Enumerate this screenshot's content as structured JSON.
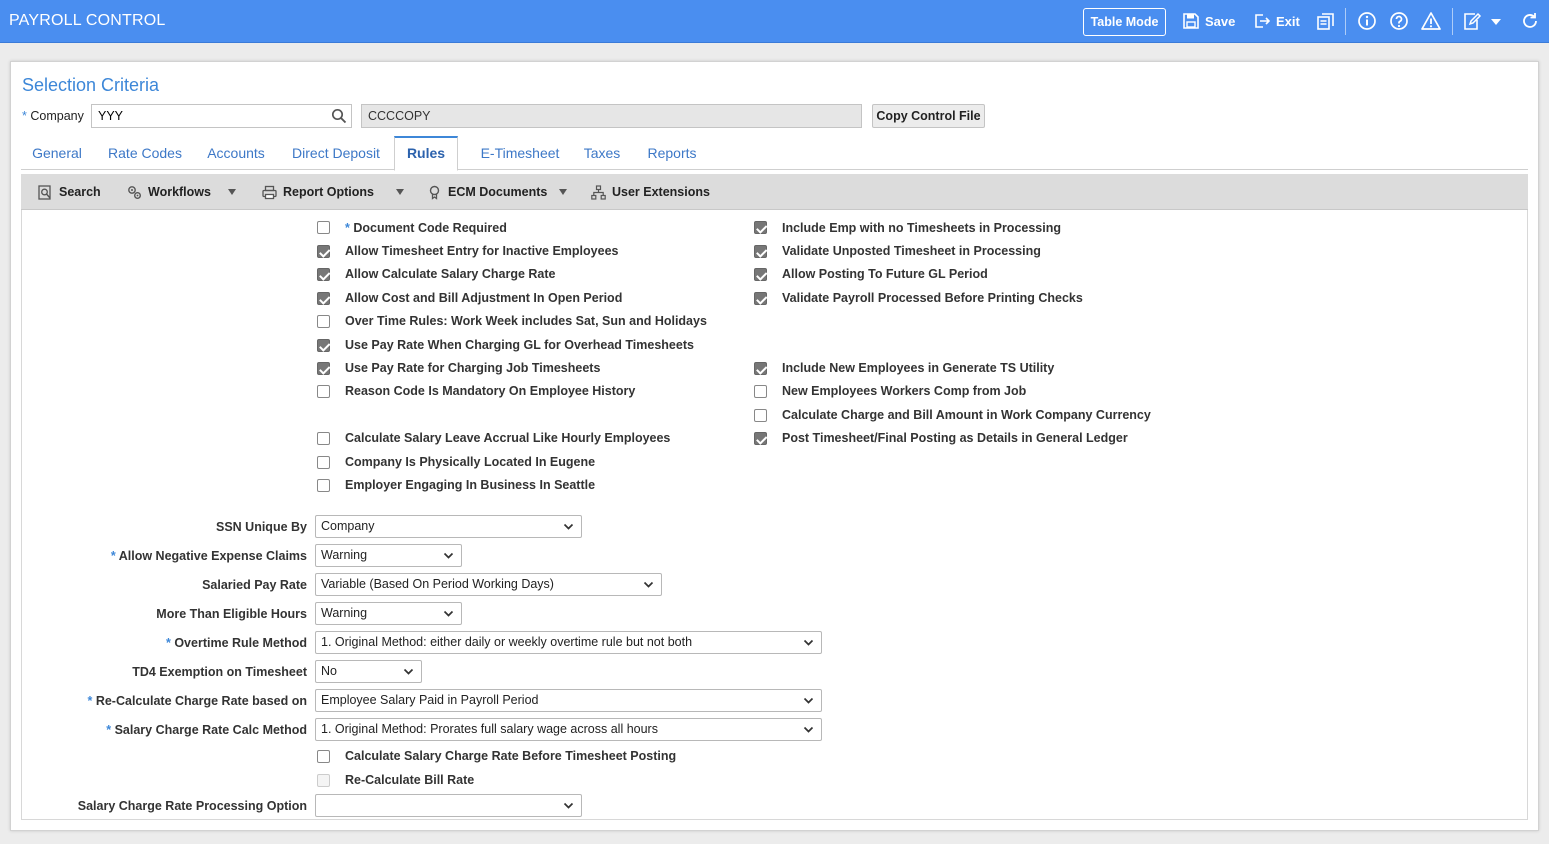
{
  "header": {
    "title": "PAYROLL CONTROL",
    "table_mode": "Table Mode",
    "save": "Save",
    "exit": "Exit"
  },
  "selection": {
    "title": "Selection Criteria",
    "required_mark": "*",
    "company_label": "Company",
    "company_value": "YYY",
    "company_name": "CCCCOPY",
    "copy_button": "Copy Control File"
  },
  "tabs": [
    "General",
    "Rate Codes",
    "Accounts",
    "Direct Deposit",
    "Rules",
    "E-Timesheet",
    "Taxes",
    "Reports"
  ],
  "active_tab": "Rules",
  "toolbar": {
    "search": "Search",
    "workflows": "Workflows",
    "report_options": "Report Options",
    "ecm_documents": "ECM Documents",
    "user_extensions": "User Extensions"
  },
  "rules_left": [
    {
      "label": "Document Code Required",
      "checked": false,
      "required": true
    },
    {
      "label": "Allow Timesheet Entry for Inactive Employees",
      "checked": true
    },
    {
      "label": "Allow Calculate Salary Charge Rate",
      "checked": true
    },
    {
      "label": "Allow Cost and Bill Adjustment In Open Period",
      "checked": true
    },
    {
      "label": "Over Time Rules: Work Week includes Sat, Sun and Holidays",
      "checked": false
    },
    {
      "label": "Use Pay Rate When Charging GL for Overhead Timesheets",
      "checked": true
    },
    {
      "label": "Use Pay Rate for Charging Job Timesheets",
      "checked": true
    },
    {
      "label": "Reason Code Is Mandatory On Employee History",
      "checked": false
    },
    {
      "label": "Calculate Salary Leave Accrual Like Hourly Employees",
      "checked": false
    },
    {
      "label": "Company Is Physically Located In Eugene",
      "checked": false
    },
    {
      "label": "Employer Engaging In Business In Seattle",
      "checked": false
    }
  ],
  "rules_right": [
    {
      "label": "Include Emp with no Timesheets in Processing",
      "checked": true
    },
    {
      "label": "Validate Unposted Timesheet in Processing",
      "checked": true
    },
    {
      "label": "Allow Posting To Future GL Period",
      "checked": true
    },
    {
      "label": "Validate Payroll Processed Before Printing Checks",
      "checked": true
    },
    {
      "label": "Include New Employees in Generate TS Utility",
      "checked": true
    },
    {
      "label": "New Employees Workers Comp from Job",
      "checked": false
    },
    {
      "label": "Calculate Charge and Bill Amount in Work Company Currency",
      "checked": false
    },
    {
      "label": "Post Timesheet/Final Posting as Details in General Ledger",
      "checked": true
    }
  ],
  "fields": [
    {
      "label": "SSN Unique By",
      "value": "Company",
      "required": false
    },
    {
      "label": "Allow Negative Expense Claims",
      "value": "Warning",
      "required": true
    },
    {
      "label": "Salaried Pay Rate",
      "value": "Variable (Based On Period Working Days)",
      "required": false
    },
    {
      "label": "More Than Eligible Hours",
      "value": "Warning",
      "required": false
    },
    {
      "label": "Overtime Rule Method",
      "value": "1. Original Method: either daily or weekly overtime rule but not both",
      "required": true
    },
    {
      "label": "TD4 Exemption on Timesheet",
      "value": "No",
      "required": false
    },
    {
      "label": "Re-Calculate Charge Rate based on",
      "value": "Employee Salary Paid in Payroll Period",
      "required": true
    },
    {
      "label": "Salary Charge Rate Calc Method",
      "value": "1. Original Method: Prorates full salary wage across all hours",
      "required": true
    }
  ],
  "bottom_checks": [
    {
      "label": "Calculate Salary Charge Rate Before Timesheet Posting",
      "checked": false
    },
    {
      "label": "Re-Calculate Bill Rate",
      "checked": false,
      "disabled": true
    }
  ],
  "last_field": {
    "label": "Salary Charge Rate Processing Option",
    "value": ""
  }
}
